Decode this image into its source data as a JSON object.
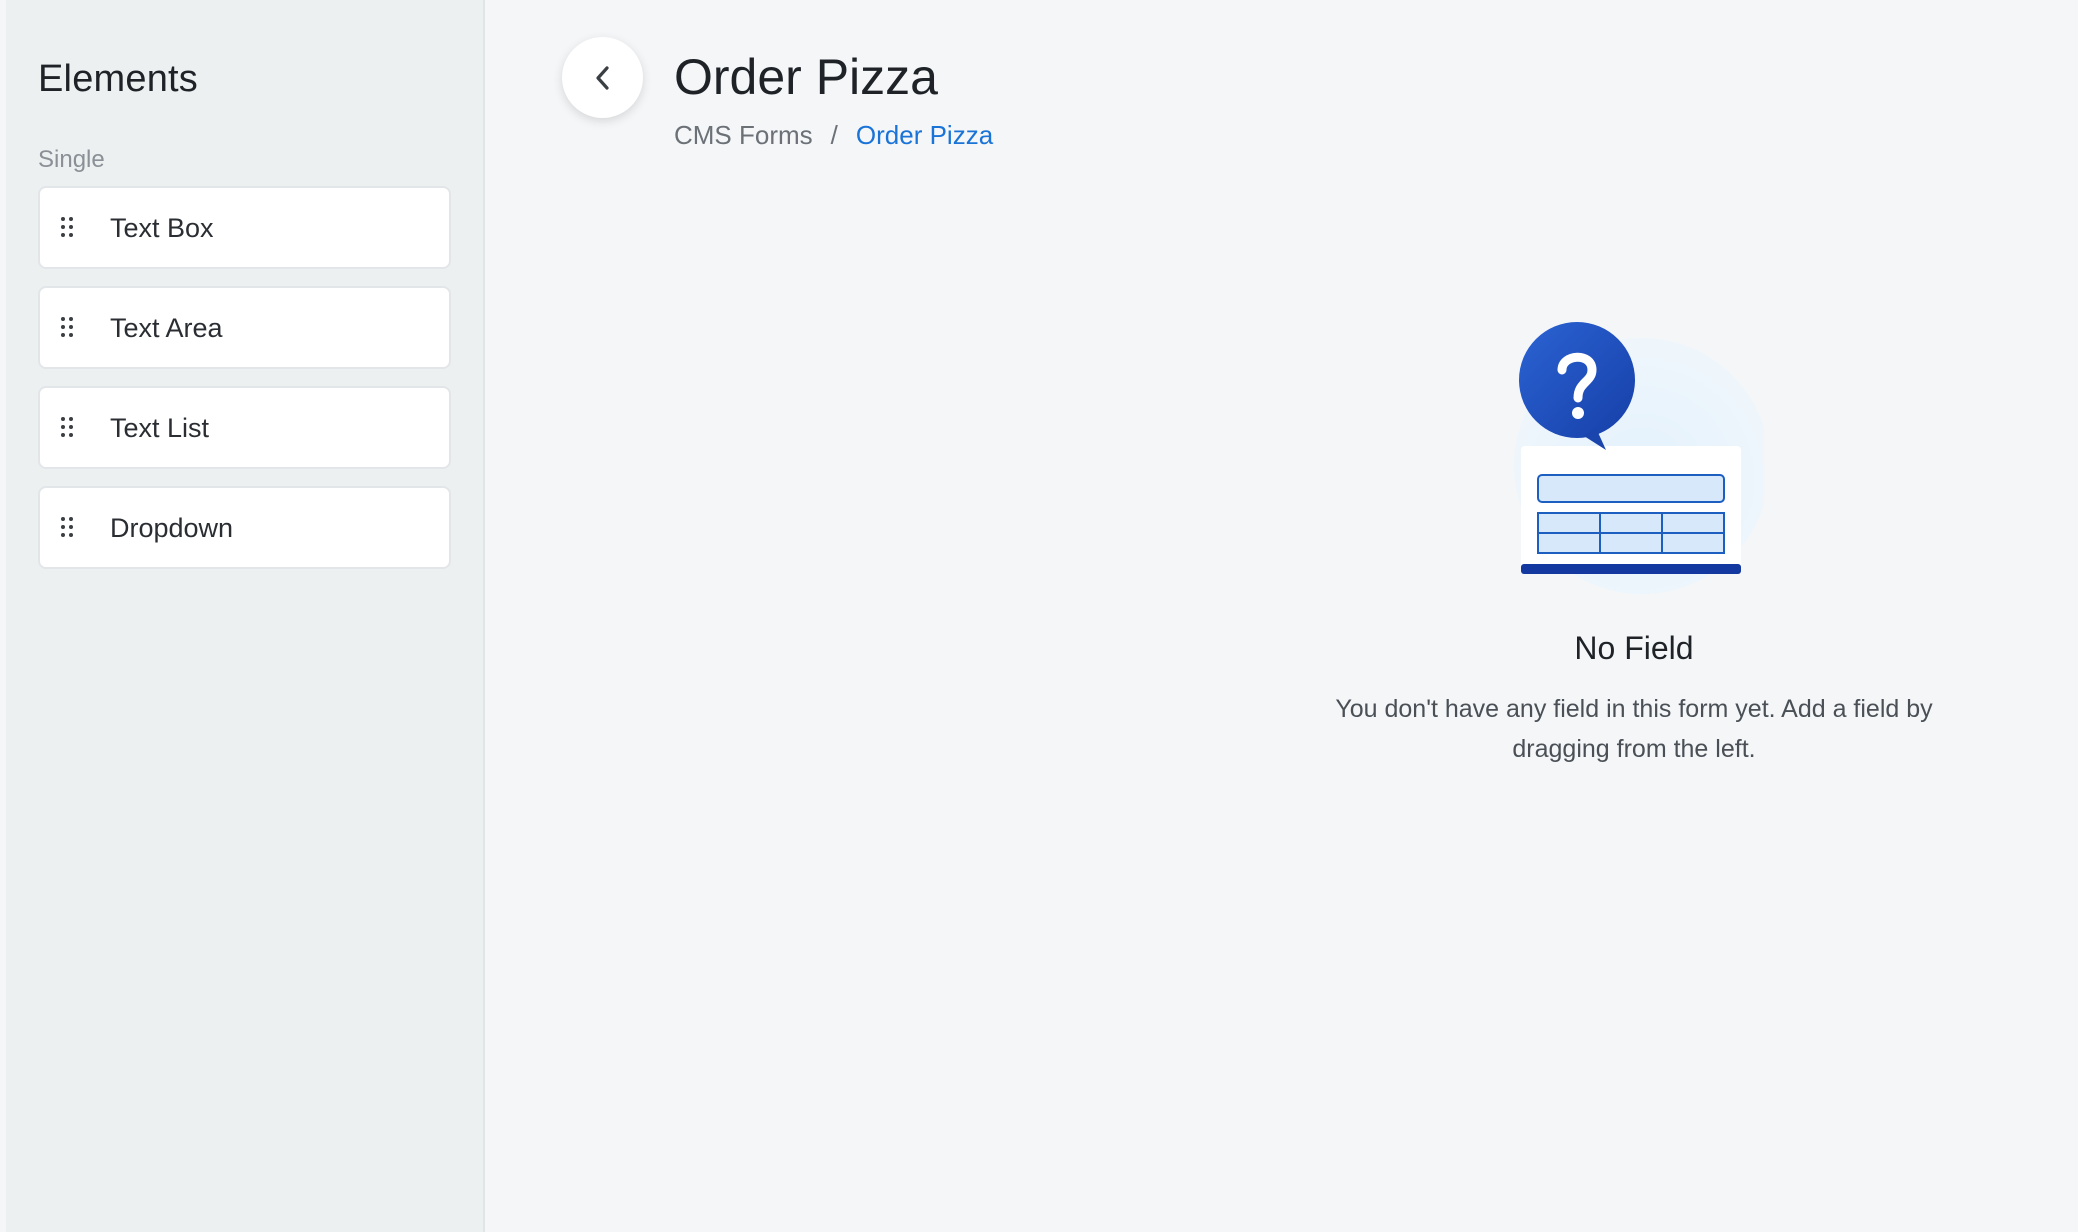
{
  "sidebar": {
    "title": "Elements",
    "section_label": "Single",
    "items": [
      {
        "label": "Text Box",
        "icon": "drag-handle-icon"
      },
      {
        "label": "Text Area",
        "icon": "drag-handle-icon"
      },
      {
        "label": "Text List",
        "icon": "drag-handle-icon"
      },
      {
        "label": "Dropdown",
        "icon": "drag-handle-icon"
      }
    ]
  },
  "header": {
    "back_icon": "chevron-left-icon",
    "title": "Order Pizza",
    "breadcrumb": {
      "parent": "CMS Forms",
      "separator": "/",
      "current": "Order Pizza"
    }
  },
  "empty_state": {
    "illustration": "question-form-illustration",
    "title": "No Field",
    "description": "You don't have any field in this form yet. Add a field by dragging from the left."
  },
  "colors": {
    "accent": "#1a73d6",
    "sidebar_bg": "#edf0f1",
    "main_bg": "#f4f6f8"
  }
}
